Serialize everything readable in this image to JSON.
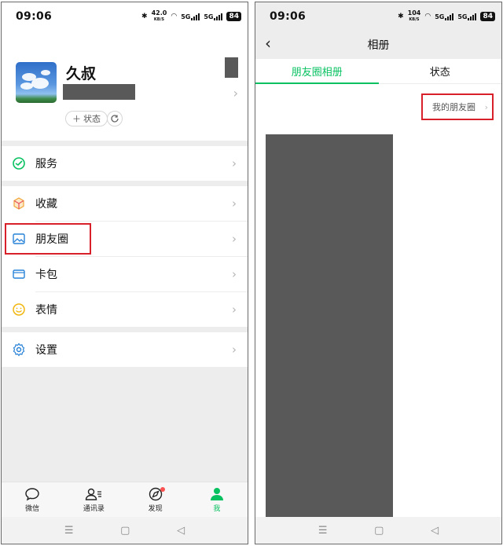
{
  "statusbar": {
    "time": "09:06",
    "left_speed_value": "42.0",
    "right_speed_value": "104",
    "speed_unit": "KB/S",
    "network": "5G",
    "battery": "84"
  },
  "left": {
    "profile": {
      "nickname": "久叔",
      "status_button": "状态"
    },
    "menu": [
      {
        "label": "服务",
        "icon": "service-icon"
      },
      {
        "label": "收藏",
        "icon": "favorites-icon"
      },
      {
        "label": "朋友圈",
        "icon": "moments-icon"
      },
      {
        "label": "卡包",
        "icon": "card-wallet-icon"
      },
      {
        "label": "表情",
        "icon": "sticker-icon"
      },
      {
        "label": "设置",
        "icon": "settings-icon"
      }
    ],
    "tabs": [
      {
        "label": "微信",
        "icon": "chat-icon"
      },
      {
        "label": "通讯录",
        "icon": "contacts-icon"
      },
      {
        "label": "发现",
        "icon": "discover-icon"
      },
      {
        "label": "我",
        "icon": "me-icon"
      }
    ]
  },
  "right": {
    "title": "相册",
    "tabs": [
      {
        "label": "朋友圈相册"
      },
      {
        "label": "状态"
      }
    ],
    "my_moments_button": "我的朋友圈"
  },
  "colors": {
    "accent": "#07c160",
    "highlight": "#d8202a",
    "redaction": "#595959",
    "background_gray": "#ededed"
  }
}
